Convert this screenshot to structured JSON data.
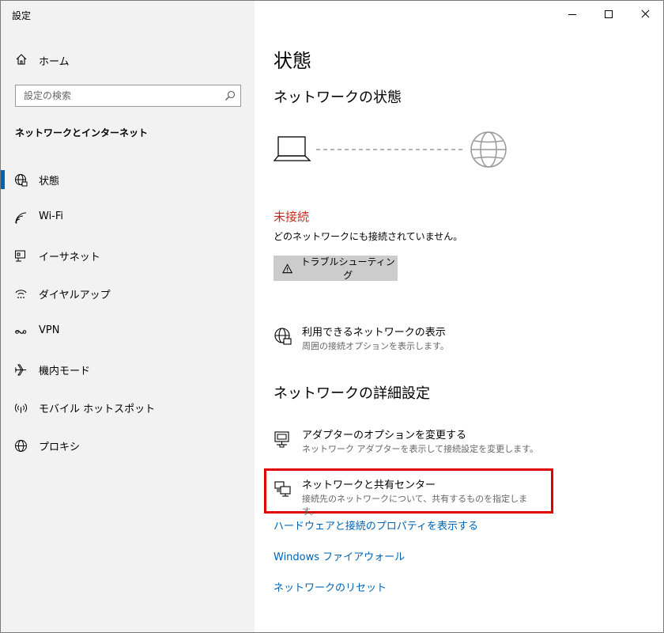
{
  "app": {
    "title": "設定"
  },
  "window_controls": {
    "minimize": "minimize-icon",
    "maximize": "maximize-icon",
    "close": "close-icon"
  },
  "sidebar": {
    "home_label": "ホーム",
    "search_placeholder": "設定の検索",
    "section_title": "ネットワークとインターネット",
    "items": [
      {
        "label": "状態",
        "icon": "globe-network-icon",
        "active": true
      },
      {
        "label": "Wi-Fi",
        "icon": "wifi-icon",
        "active": false
      },
      {
        "label": "イーサネット",
        "icon": "ethernet-icon",
        "active": false
      },
      {
        "label": "ダイヤルアップ",
        "icon": "dialup-icon",
        "active": false
      },
      {
        "label": "VPN",
        "icon": "vpn-icon",
        "active": false
      },
      {
        "label": "機内モード",
        "icon": "airplane-icon",
        "active": false
      },
      {
        "label": "モバイル ホットスポット",
        "icon": "hotspot-icon",
        "active": false
      },
      {
        "label": "プロキシ",
        "icon": "proxy-globe-icon",
        "active": false
      }
    ]
  },
  "main": {
    "title": "状態",
    "network_status_heading": "ネットワークの状態",
    "status": "未接続",
    "status_description": "どのネットワークにも接続されていません。",
    "troubleshoot_label": "トラブルシューティング",
    "show_networks": {
      "title": "利用できるネットワークの表示",
      "description": "周囲の接続オプションを表示します。"
    },
    "advanced_heading": "ネットワークの詳細設定",
    "adapter_options": {
      "title": "アダプターのオプションを変更する",
      "description": "ネットワーク アダプターを表示して接続設定を変更します。"
    },
    "sharing_center": {
      "title": "ネットワークと共有センター",
      "description": "接続先のネットワークについて、共有するものを指定します。"
    },
    "links": {
      "hardware_properties": "ハードウェアと接続のプロパティを表示する",
      "firewall": "Windows ファイアウォール",
      "reset": "ネットワークのリセット"
    }
  },
  "colors": {
    "accent": "#0063b1",
    "error": "#c42b1c",
    "highlight": "#e00000",
    "sidebar_bg": "#f2f2f2"
  }
}
